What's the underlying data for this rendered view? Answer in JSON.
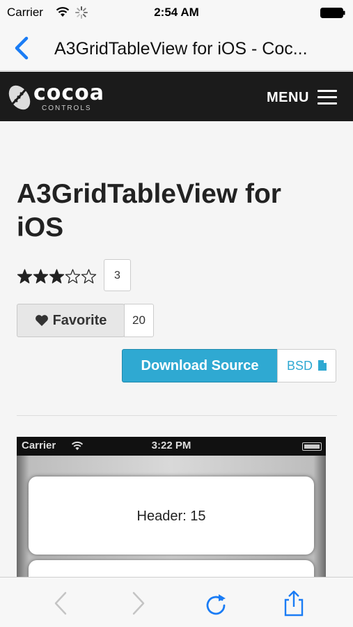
{
  "status_bar": {
    "carrier": "Carrier",
    "time": "2:54 AM"
  },
  "nav_bar": {
    "title": "A3GridTableView for iOS - Coc..."
  },
  "site_header": {
    "logo_word": "cocoa",
    "logo_sub": "CONTROLS",
    "menu_label": "MENU"
  },
  "control": {
    "title": "A3GridTableView for iOS",
    "rating": {
      "filled": 3,
      "max": 5,
      "count": "3"
    },
    "favorite": {
      "label": "Favorite",
      "count": "20"
    },
    "download_label": "Download Source",
    "license": "BSD"
  },
  "preview": {
    "carrier": "Carrier",
    "time": "3:22 PM",
    "header_text": "Header: 15"
  },
  "toolbar": {
    "icons": [
      "back-arrow-icon",
      "forward-arrow-icon",
      "reload-icon",
      "share-icon"
    ]
  },
  "colors": {
    "accent": "#2fa9d2",
    "ios_blue": "#1a7cf5",
    "header_bg": "#1b1b1b"
  }
}
